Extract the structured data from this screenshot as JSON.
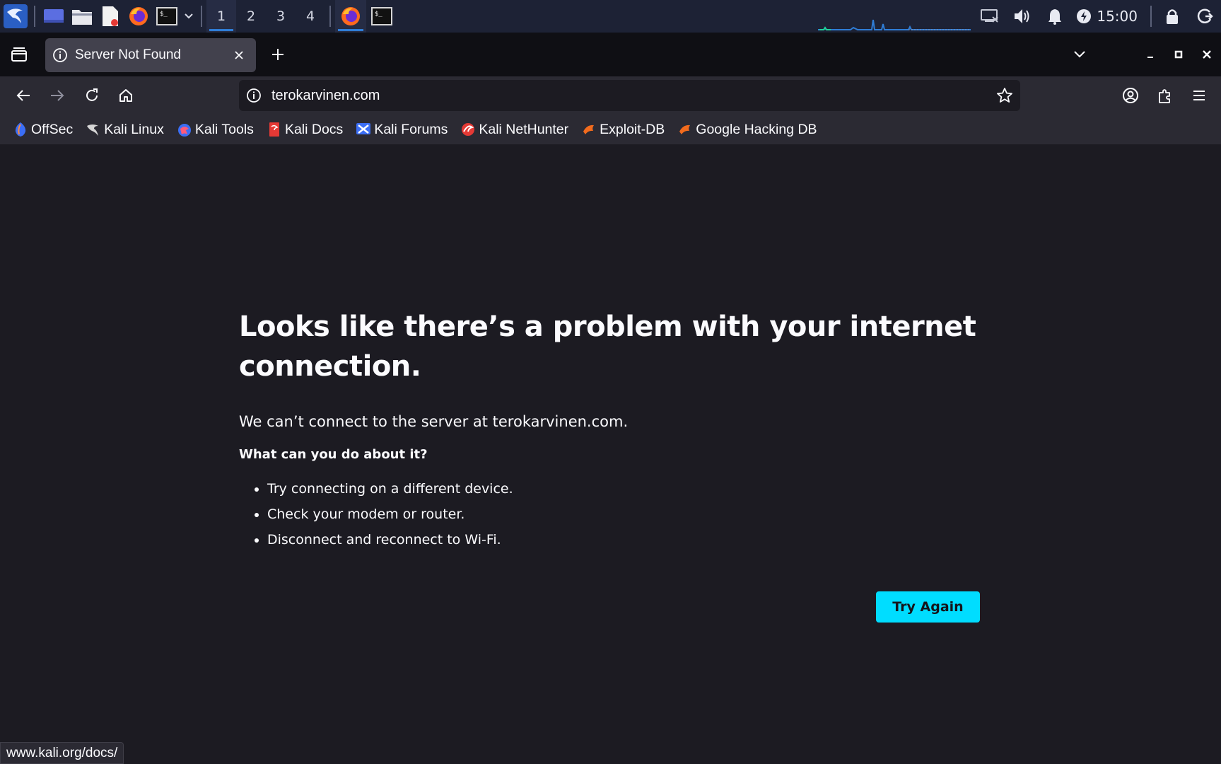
{
  "taskbar": {
    "workspaces": [
      "1",
      "2",
      "3",
      "4"
    ],
    "active_workspace": "1",
    "clock": "15:00"
  },
  "tabs": [
    {
      "title": "Server Not Found",
      "active": true
    }
  ],
  "navbar": {
    "url": "terokarvinen.com"
  },
  "bookmarks": [
    {
      "label": "OffSec",
      "icon": "offsec-icon"
    },
    {
      "label": "Kali Linux",
      "icon": "kali-dragon-icon"
    },
    {
      "label": "Kali Tools",
      "icon": "kali-tools-icon"
    },
    {
      "label": "Kali Docs",
      "icon": "kali-docs-icon"
    },
    {
      "label": "Kali Forums",
      "icon": "kali-forums-icon"
    },
    {
      "label": "Kali NetHunter",
      "icon": "nethunter-icon"
    },
    {
      "label": "Exploit-DB",
      "icon": "exploit-db-icon"
    },
    {
      "label": "Google Hacking DB",
      "icon": "ghdb-icon"
    }
  ],
  "error": {
    "title": "Looks like there’s a problem with your internet connection.",
    "description": "We can’t connect to the server at terokarvinen.com.",
    "subtitle": "What can you do about it?",
    "suggestions": [
      "Try connecting on a different device.",
      "Check your modem or router.",
      "Disconnect and reconnect to Wi-Fi."
    ],
    "button_label": "Try Again"
  },
  "status_url": "www.kali.org/docs/",
  "colors": {
    "accent": "#00ddff",
    "background": "#1c1b22",
    "toolbar": "#2b2a33",
    "taskbar": "#1d2235"
  }
}
